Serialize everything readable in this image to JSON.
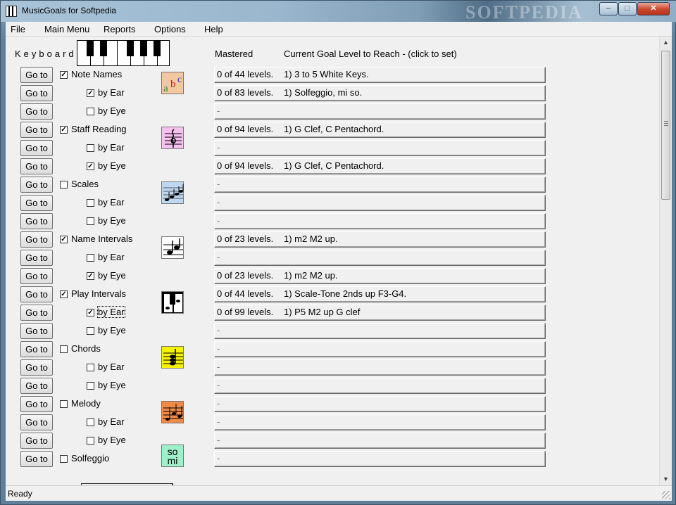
{
  "window": {
    "title": "MusicGoals for Softpedia",
    "watermark": "SOFTPEDIA",
    "minimize": "–",
    "maximize": "□",
    "close": "✕"
  },
  "menu": [
    "File",
    "Main Menu",
    "Reports",
    "Options",
    "Help"
  ],
  "keyboard_label": "Keyboard",
  "headers": {
    "mastered": "Mastered",
    "current_goal": "Current Goal Level to Reach - (click to set)"
  },
  "goto_label": "Go to",
  "rows": [
    {
      "label": "Note Names",
      "checked": true,
      "mastered": "0 of 44 levels.",
      "goal": "1) 3 to 5 White Keys."
    },
    {
      "label": "by Ear",
      "checked": true,
      "mastered": "0 of 83 levels.",
      "goal": "1) Solfeggio, mi so."
    },
    {
      "label": "by Eye",
      "checked": false,
      "mastered": "",
      "goal": "-"
    },
    {
      "label": "Staff Reading",
      "checked": true,
      "mastered": "0 of 94 levels.",
      "goal": "1) G Clef, C Pentachord."
    },
    {
      "label": "by Ear",
      "checked": false,
      "mastered": "",
      "goal": "-"
    },
    {
      "label": "by Eye",
      "checked": true,
      "mastered": "0 of 94 levels.",
      "goal": "1) G Clef, C Pentachord."
    },
    {
      "label": "Scales",
      "checked": false,
      "mastered": "",
      "goal": "-"
    },
    {
      "label": "by Ear",
      "checked": false,
      "mastered": "",
      "goal": "-"
    },
    {
      "label": "by Eye",
      "checked": false,
      "mastered": "",
      "goal": "-"
    },
    {
      "label": "Name Intervals",
      "checked": true,
      "mastered": "0 of 23 levels.",
      "goal": "1) m2 M2 up."
    },
    {
      "label": "by Ear",
      "checked": false,
      "mastered": "",
      "goal": "-"
    },
    {
      "label": "by Eye",
      "checked": true,
      "mastered": "0 of 23 levels.",
      "goal": "1) m2 M2 up."
    },
    {
      "label": "Play Intervals",
      "checked": true,
      "mastered": "0 of 44 levels.",
      "goal": "1) Scale-Tone 2nds up F3-G4."
    },
    {
      "label": "by Ear",
      "checked": true,
      "mastered": "0 of 99 levels.",
      "goal": "1) P5 M2 up G clef"
    },
    {
      "label": "by Eye",
      "checked": false,
      "mastered": "",
      "goal": "-"
    },
    {
      "label": "Chords",
      "checked": false,
      "mastered": "",
      "goal": "-"
    },
    {
      "label": "by Ear",
      "checked": false,
      "mastered": "",
      "goal": "-"
    },
    {
      "label": "by Eye",
      "checked": false,
      "mastered": "",
      "goal": "-"
    },
    {
      "label": "Melody",
      "checked": false,
      "mastered": "",
      "goal": "-"
    },
    {
      "label": "by Ear",
      "checked": false,
      "mastered": "",
      "goal": "-"
    },
    {
      "label": "by Eye",
      "checked": false,
      "mastered": "",
      "goal": "-"
    },
    {
      "label": "Solfeggio",
      "checked": false,
      "mastered": "",
      "goal": "-"
    }
  ],
  "icons": {
    "note_names": {
      "text_a": "a",
      "text_b": "b",
      "text_c": "c",
      "color": "#f3c7a0"
    },
    "staff_reading": {
      "color": "#f6c0f0"
    },
    "scales": {
      "color": "#bcd8f2"
    },
    "name_intervals": {
      "color": "#ffffff"
    },
    "play_intervals": {
      "color": "#000000"
    },
    "chords": {
      "color": "#f7f200"
    },
    "melody": {
      "color": "#f08a48"
    },
    "solfeggio": {
      "line1": "so",
      "line2": "mi",
      "color": "#9ef0c9"
    }
  },
  "status": "Ready"
}
